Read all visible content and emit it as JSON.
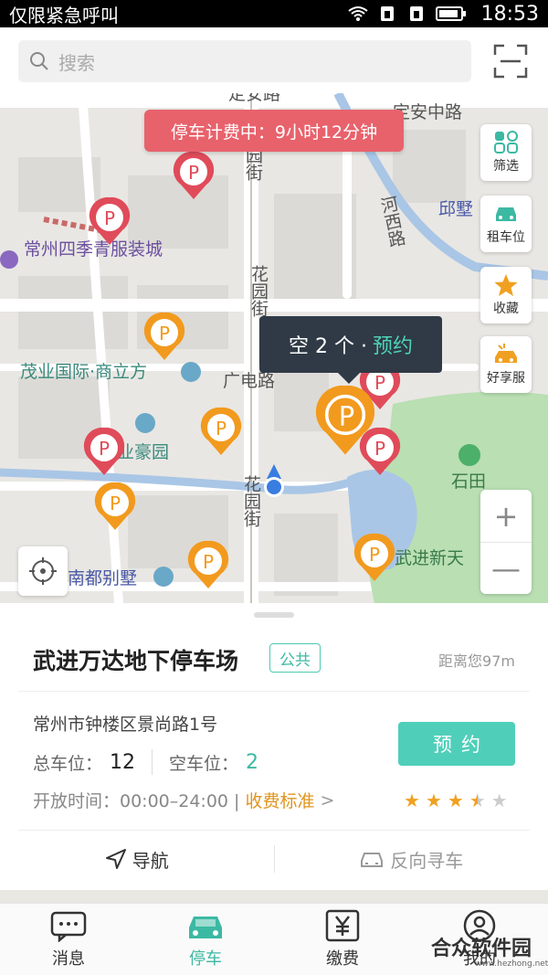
{
  "status_bar": {
    "carrier": "仅限紧急呼叫",
    "time": "18:53"
  },
  "search": {
    "placeholder": "搜索"
  },
  "map": {
    "fee_banner": "停车计费中：9小时12分钟",
    "roads": {
      "dingan_top": "定安路",
      "dingan_right": "定安中路",
      "yun_jie": "园街",
      "huayuan_1": "花园街",
      "huayuan_2": "花园街",
      "guangdian": "广电路",
      "hexi": "河西路",
      "qiushu": "邱墅"
    },
    "pois": {
      "siji": "常州四季青服装城",
      "maoye": "茂业国际·商立方",
      "yeyuan": "业豪园",
      "nandu": "南都别墅",
      "shitian": "石田",
      "wujin": "武进新天"
    },
    "popup": {
      "text": "空 2 个 ·",
      "action": "预约"
    },
    "side_buttons": [
      "筛选",
      "租车位",
      "收藏",
      "好享服"
    ],
    "zoom_in": "+",
    "zoom_out": "—"
  },
  "lot": {
    "name": "武进万达地下停车场",
    "tag": "公共",
    "distance": "距离您97m",
    "address": "常州市钟楼区景尚路1号",
    "total_label": "总车位：",
    "total_value": "12",
    "free_label": "空车位：",
    "free_value": "2",
    "hours": "开放时间：00:00–24:00 |",
    "fee_link": "收费标准",
    "fee_arrow": ">",
    "reserve": "预约",
    "rating": 3.5
  },
  "actions": {
    "navigate": "导航",
    "find_car": "反向寻车"
  },
  "tabs": [
    {
      "label": "消息",
      "icon": "message-icon"
    },
    {
      "label": "停车",
      "icon": "car-icon"
    },
    {
      "label": "缴费",
      "icon": "yen-icon"
    },
    {
      "label": "我的",
      "icon": "user-icon"
    }
  ],
  "watermark": {
    "text": "合众软件园",
    "sub": "www.hezhong.net"
  },
  "colors": {
    "accent": "#3cb9a3",
    "fee_banner": "#e8626c",
    "lot_pin": "#f29a1e",
    "occupied_pin": "#e04b5a"
  }
}
